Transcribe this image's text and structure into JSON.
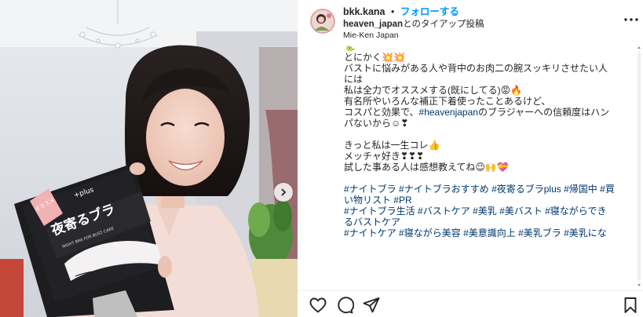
{
  "header": {
    "username": "bkk.kana",
    "separator": "•",
    "follow_label": "フォローする",
    "partner": "heaven_japan",
    "partner_suffix": "とのタイアップ投稿",
    "location": "Mie-Ken Japan"
  },
  "icons": {
    "more": "more-horizontal-icon",
    "like": "heart-icon",
    "comment": "comment-icon",
    "share": "paper-plane-icon",
    "save": "bookmark-icon",
    "carousel_next": "chevron-right-icon"
  },
  "product": {
    "badge": "オススメ",
    "plus": "+plus",
    "name": "夜寄るブラ",
    "tagline": "NIGHT BRA FOR BUST CARE"
  },
  "caption": {
    "line0": "🐍",
    "line1": "とにかく💥💥",
    "line2": "バストに悩みがある人や背中のお肉二の腕スッキリさせたい人",
    "line3": "には",
    "line4": "私は全力でオススメする(既にしてる)😡🔥",
    "line5": "有名所やいろんな補正下着使ったことあるけど、",
    "line6a": "コスパと効果で、",
    "line6tag": "#heavenjapan",
    "line6b": "のブラジャーへの信頼度はハン",
    "line7": "パないから☺❣",
    "line8": "",
    "line9": "きっと私は一生コレ👍",
    "line10": "メッチャ好き❣❣❣",
    "line11": "試した事ある人は感想教えてね😉🙌💝",
    "line12": "",
    "tags1": [
      "#ナイトブラ",
      "#ナイトブラおすすめ",
      "#夜寄るブラplus",
      "#帰国中",
      "#買"
    ],
    "tags2": [
      "い物リスト",
      "#PR"
    ],
    "tags3": [
      "#ナイトブラ生活",
      "#バストケア",
      "#美乳",
      "#美バスト",
      "#寝ながらでき"
    ],
    "tags4": [
      "るバストケア"
    ],
    "tags5": [
      "#ナイトケア",
      "#寝ながら美容",
      "#美意識向上",
      "#美乳ブラ",
      "#美乳にな"
    ]
  },
  "colors": {
    "accent_blue": "#0095f6",
    "hashtag": "#00376b",
    "text": "#262626"
  }
}
